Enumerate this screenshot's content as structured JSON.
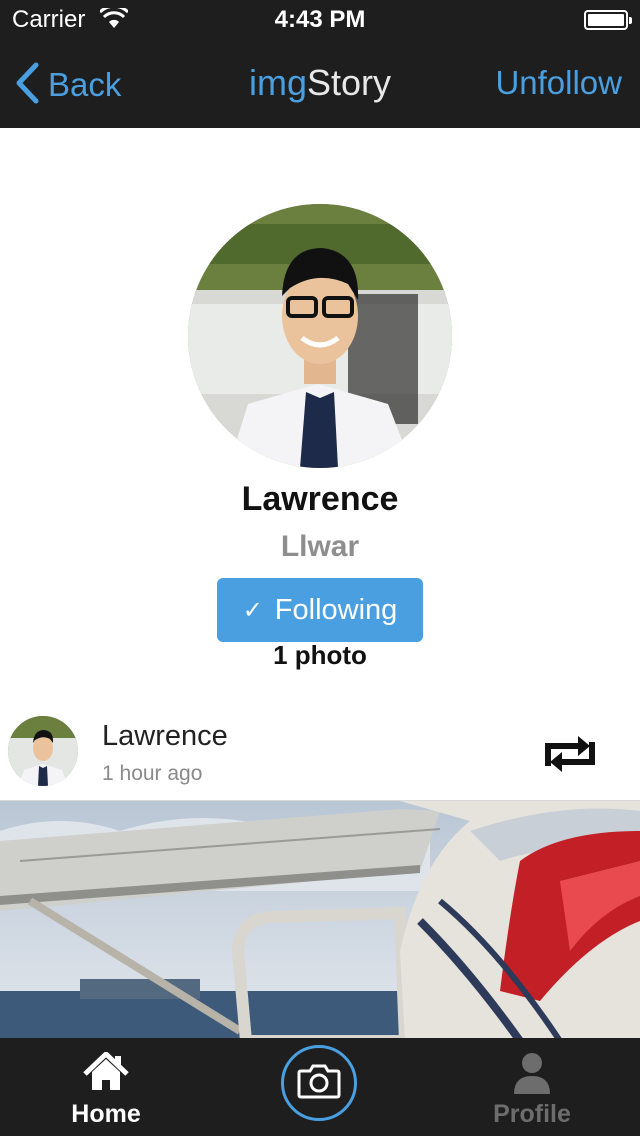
{
  "status_bar": {
    "carrier": "Carrier",
    "time": "4:43 PM"
  },
  "nav": {
    "back_label": "Back",
    "title_part1": "img",
    "title_part2": "Story",
    "unfollow_label": "Unfollow"
  },
  "profile": {
    "name": "Lawrence",
    "username": "Llwar",
    "follow_state": "Following",
    "photo_count": "1 photo"
  },
  "post": {
    "author": "Lawrence",
    "time_ago": "1 hour ago"
  },
  "tabbar": {
    "home_label": "Home",
    "profile_label": "Profile"
  },
  "icons": [
    "wifi-icon",
    "battery-icon",
    "back-chevron-icon",
    "check-icon",
    "repost-icon",
    "home-icon",
    "camera-icon",
    "person-icon"
  ],
  "colors": {
    "accent": "#4a9fe0",
    "bar_bg": "#1e1e1e",
    "inactive_tab": "#6d6d6d"
  }
}
